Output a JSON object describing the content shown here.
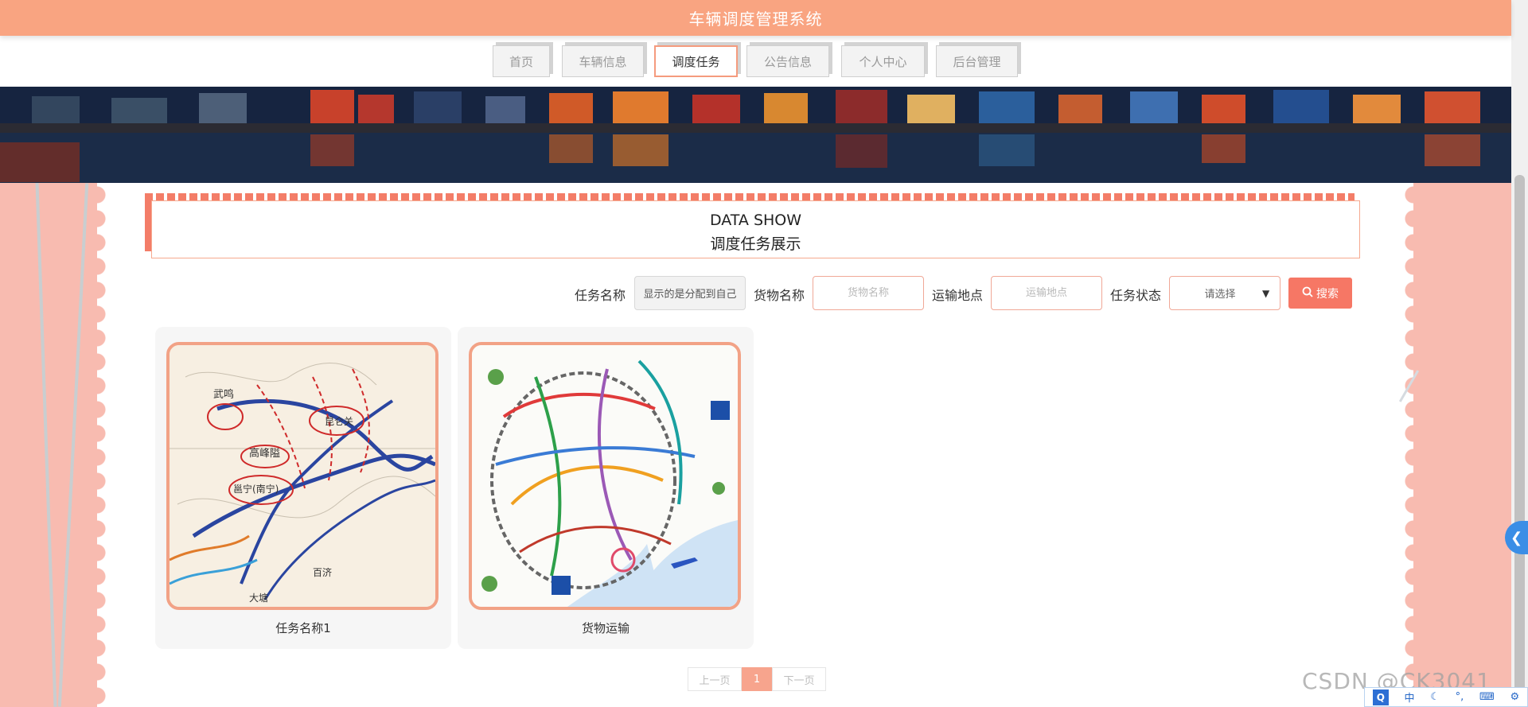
{
  "header": {
    "title": "车辆调度管理系统"
  },
  "nav": {
    "items": [
      "首页",
      "车辆信息",
      "调度任务",
      "公告信息",
      "个人中心",
      "后台管理"
    ]
  },
  "section": {
    "title_en": "DATA SHOW",
    "title_cn": "调度任务展示"
  },
  "search": {
    "task_name_label": "任务名称",
    "task_name_value": "显示的是分配到自己",
    "goods_name_label": "货物名称",
    "goods_name_placeholder": "货物名称",
    "location_label": "运输地点",
    "location_placeholder": "运输地点",
    "status_label": "任务状态",
    "status_selected": "请选择",
    "button_label": "搜索"
  },
  "cards": [
    {
      "title": "任务名称1"
    },
    {
      "title": "货物运输"
    }
  ],
  "pagination": {
    "prev": "上一页",
    "current": "1",
    "next": "下一页"
  },
  "map1_labels": {
    "city1": "武鸣",
    "city2": "高峰隘",
    "city3": "邕宁(南宁)",
    "city4": "昆仑关",
    "city5": "百济",
    "city6": "大塘"
  },
  "watermark": "CSDN @CK3041",
  "ime": {
    "q": "Q",
    "zh": "中"
  },
  "colors": {
    "accent": "#f9a481",
    "button": "#f67765",
    "page_bg": "#fbd3cc"
  }
}
